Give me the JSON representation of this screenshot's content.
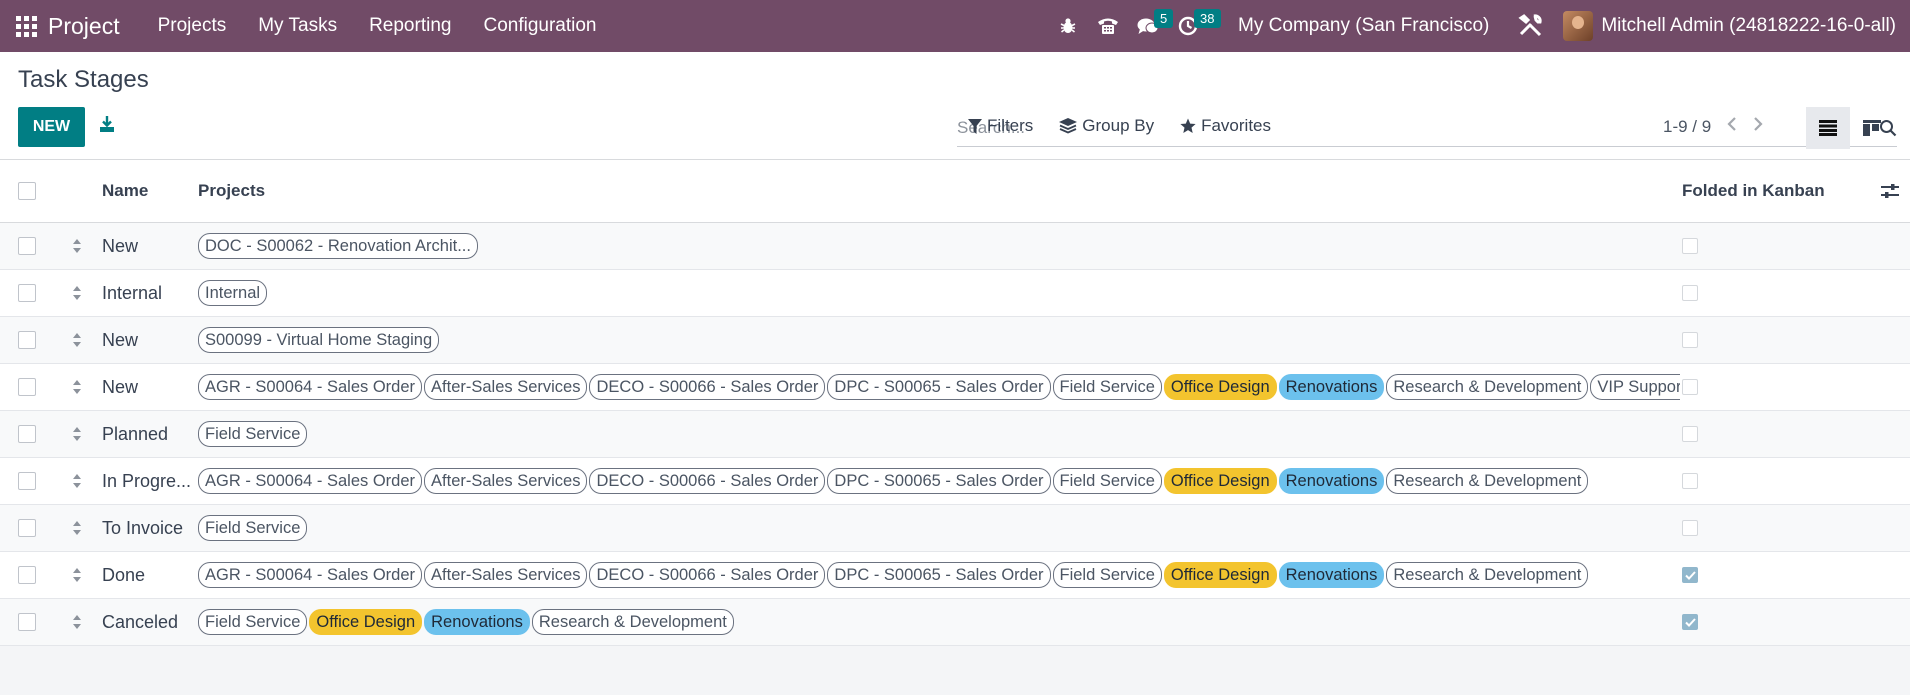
{
  "navbar": {
    "app_name": "Project",
    "menu": [
      "Projects",
      "My Tasks",
      "Reporting",
      "Configuration"
    ],
    "messages_count": "5",
    "activities_count": "38",
    "company": "My Company (San Francisco)",
    "user": "Mitchell Admin (24818222-16-0-all)"
  },
  "control": {
    "title": "Task Stages",
    "new_label": "NEW",
    "search_placeholder": "Search...",
    "filters_label": "Filters",
    "groupby_label": "Group By",
    "favorites_label": "Favorites",
    "pager": "1-9 / 9"
  },
  "table": {
    "headers": {
      "name": "Name",
      "projects": "Projects",
      "folded": "Folded in Kanban"
    },
    "rows": [
      {
        "name": "New",
        "folded": false,
        "tags": [
          {
            "label": "DOC - S00062 - Renovation Archit...",
            "color": "none"
          }
        ]
      },
      {
        "name": "Internal",
        "folded": false,
        "tags": [
          {
            "label": "Internal",
            "color": "none"
          }
        ]
      },
      {
        "name": "New",
        "folded": false,
        "tags": [
          {
            "label": "S00099 - Virtual Home Staging",
            "color": "none"
          }
        ]
      },
      {
        "name": "New",
        "folded": false,
        "tags": [
          {
            "label": "AGR - S00064 - Sales Order",
            "color": "none"
          },
          {
            "label": "After-Sales Services",
            "color": "none"
          },
          {
            "label": "DECO - S00066 - Sales Order",
            "color": "none"
          },
          {
            "label": "DPC - S00065 - Sales Order",
            "color": "none"
          },
          {
            "label": "Field Service",
            "color": "none"
          },
          {
            "label": "Office Design",
            "color": "yellow"
          },
          {
            "label": "Renovations",
            "color": "blue"
          },
          {
            "label": "Research & Development",
            "color": "none"
          },
          {
            "label": "VIP Support",
            "color": "none"
          }
        ]
      },
      {
        "name": "Planned",
        "folded": false,
        "tags": [
          {
            "label": "Field Service",
            "color": "none"
          }
        ]
      },
      {
        "name": "In Progre...",
        "folded": false,
        "tags": [
          {
            "label": "AGR - S00064 - Sales Order",
            "color": "none"
          },
          {
            "label": "After-Sales Services",
            "color": "none"
          },
          {
            "label": "DECO - S00066 - Sales Order",
            "color": "none"
          },
          {
            "label": "DPC - S00065 - Sales Order",
            "color": "none"
          },
          {
            "label": "Field Service",
            "color": "none"
          },
          {
            "label": "Office Design",
            "color": "yellow"
          },
          {
            "label": "Renovations",
            "color": "blue"
          },
          {
            "label": "Research & Development",
            "color": "none"
          }
        ]
      },
      {
        "name": "To Invoice",
        "folded": false,
        "tags": [
          {
            "label": "Field Service",
            "color": "none"
          }
        ]
      },
      {
        "name": "Done",
        "folded": true,
        "tags": [
          {
            "label": "AGR - S00064 - Sales Order",
            "color": "none"
          },
          {
            "label": "After-Sales Services",
            "color": "none"
          },
          {
            "label": "DECO - S00066 - Sales Order",
            "color": "none"
          },
          {
            "label": "DPC - S00065 - Sales Order",
            "color": "none"
          },
          {
            "label": "Field Service",
            "color": "none"
          },
          {
            "label": "Office Design",
            "color": "yellow"
          },
          {
            "label": "Renovations",
            "color": "blue"
          },
          {
            "label": "Research & Development",
            "color": "none"
          }
        ]
      },
      {
        "name": "Canceled",
        "folded": true,
        "tags": [
          {
            "label": "Field Service",
            "color": "none"
          },
          {
            "label": "Office Design",
            "color": "yellow"
          },
          {
            "label": "Renovations",
            "color": "blue"
          },
          {
            "label": "Research & Development",
            "color": "none"
          }
        ]
      }
    ]
  },
  "colors": {
    "navbar": "#714b67",
    "primary": "#017e84",
    "tag_yellow": "#f3c42e",
    "tag_blue": "#6cc1ed"
  }
}
